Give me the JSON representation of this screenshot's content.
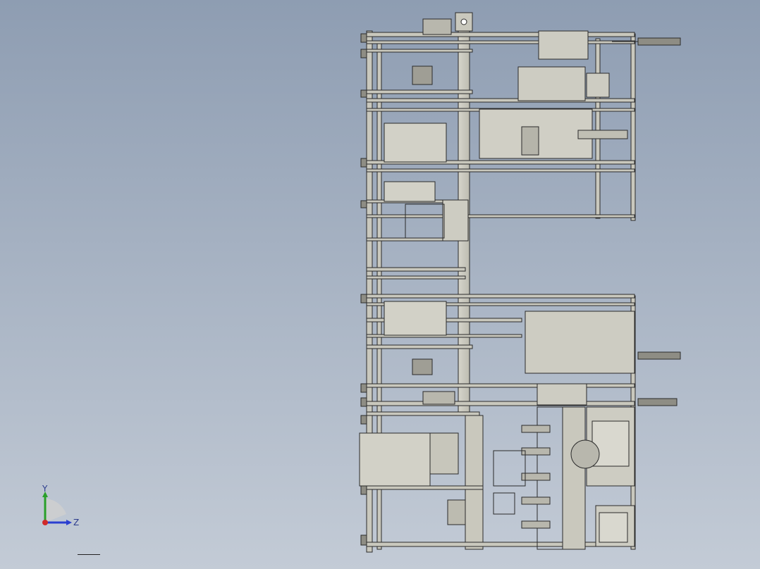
{
  "viewport": {
    "background_top": "#8e9db2",
    "background_bottom": "#c3cbd6"
  },
  "model": {
    "line_color": "#2a2a2a",
    "fill_color": "#c9c8bd",
    "fill_dark": "#8e8d84"
  },
  "triad": {
    "y_label": "Y",
    "z_label": "Z",
    "y_color": "#2aa02a",
    "z_color": "#2a3fd0",
    "x_color": "#d02a2a"
  }
}
